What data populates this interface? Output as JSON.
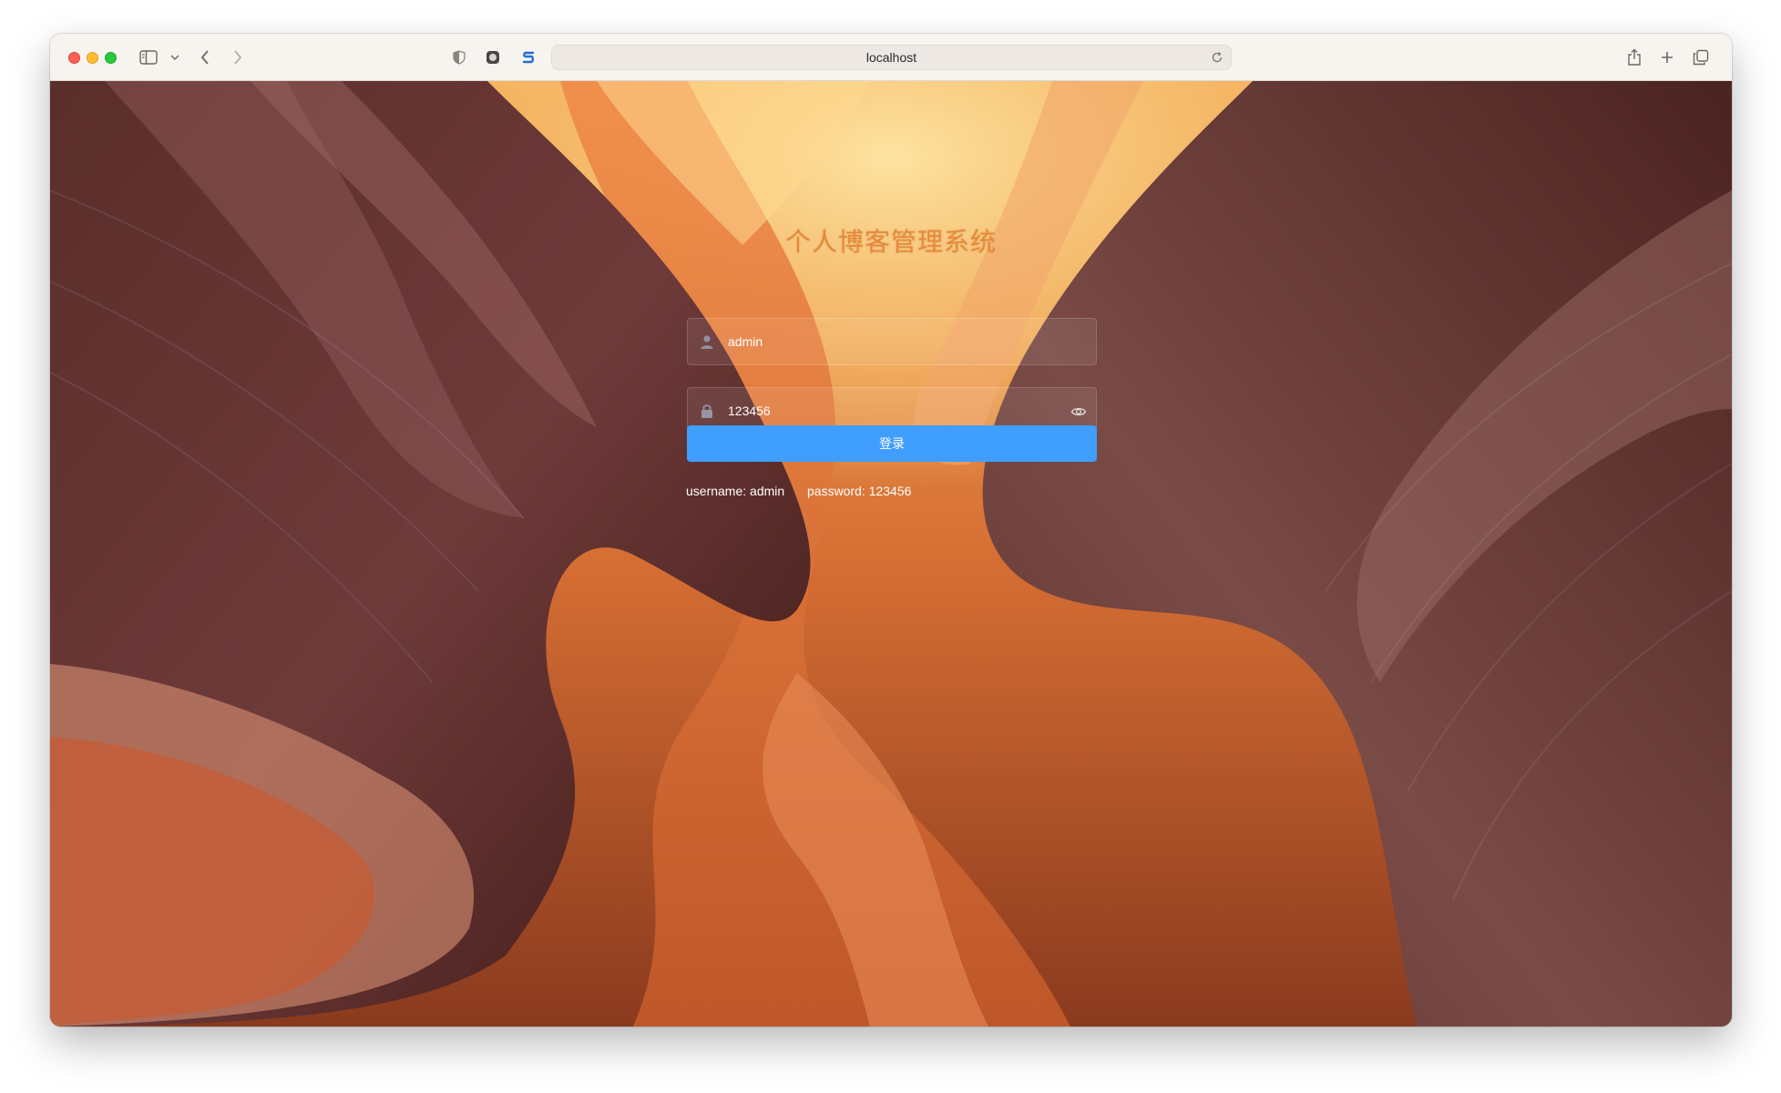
{
  "browser": {
    "url": "localhost",
    "icons": [
      "sidebar-icon",
      "chevron-down-icon",
      "back-icon",
      "forward-icon",
      "shield-icon",
      "record-icon",
      "extension-s-icon",
      "reload-icon",
      "share-icon",
      "new-tab-icon",
      "tabs-overview-icon"
    ]
  },
  "login": {
    "title": "个人博客管理系统",
    "username_value": "admin",
    "password_value": "123456",
    "submit_label": "登录",
    "hint_username": "username: admin",
    "hint_password": "password: 123456"
  },
  "colors": {
    "primary_button": "#409eff",
    "title": "#e6893b"
  }
}
